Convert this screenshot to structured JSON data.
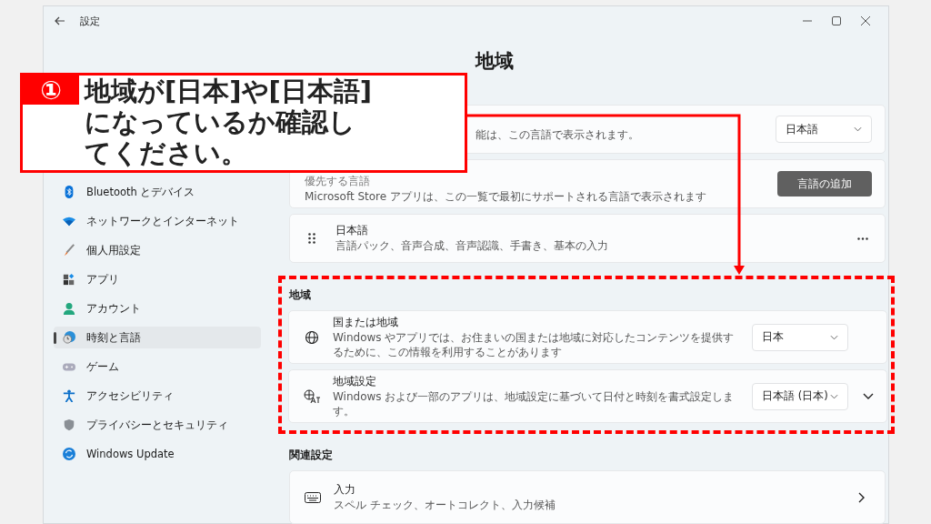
{
  "window": {
    "title": "設定"
  },
  "callout": {
    "number": "①",
    "lines": [
      "地域が[日本]や[日本語]",
      "になっているか確認し",
      "てください。"
    ]
  },
  "page_heading": "地域",
  "sidebar": {
    "items": [
      {
        "label": "Bluetooth とデバイス",
        "selected": false
      },
      {
        "label": "ネットワークとインターネット",
        "selected": false
      },
      {
        "label": "個人用設定",
        "selected": false
      },
      {
        "label": "アプリ",
        "selected": false
      },
      {
        "label": "アカウント",
        "selected": false
      },
      {
        "label": "時刻と言語",
        "selected": true
      },
      {
        "label": "ゲーム",
        "selected": false
      },
      {
        "label": "アクセシビリティ",
        "selected": false
      },
      {
        "label": "プライバシーとセキュリティ",
        "selected": false
      },
      {
        "label": "Windows Update",
        "selected": false
      }
    ]
  },
  "language_section": {
    "cards": [
      {
        "kind": "dropdown",
        "subtitle": "能は、この言語で表示されます。",
        "value": "日本語"
      },
      {
        "kind": "button",
        "title": "優先する言語",
        "subtitle": "Microsoft Store アプリは、この一覧で最初にサポートされる言語で表示されます",
        "button": "言語の追加"
      },
      {
        "kind": "menu",
        "title": "日本語",
        "subtitle": "言語パック、音声合成、音声認識、手書き、基本の入力"
      }
    ]
  },
  "region_section": {
    "label": "地域",
    "cards": [
      {
        "kind": "dropdown",
        "title": "国または地域",
        "subtitle": "Windows やアプリでは、お住まいの国または地域に対応したコンテンツを提供するために、この情報を利用することがあります",
        "value": "日本"
      },
      {
        "kind": "dropdown_expand",
        "title": "地域設定",
        "subtitle": "Windows および一部のアプリは、地域設定に基づいて日付と時刻を書式設定します。",
        "value": "日本語 (日本)",
        "expanded": false
      }
    ]
  },
  "related_section": {
    "label": "関連設定",
    "cards": [
      {
        "kind": "link",
        "title": "入力",
        "subtitle": "スペル チェック、オートコレクト、入力候補"
      }
    ]
  }
}
